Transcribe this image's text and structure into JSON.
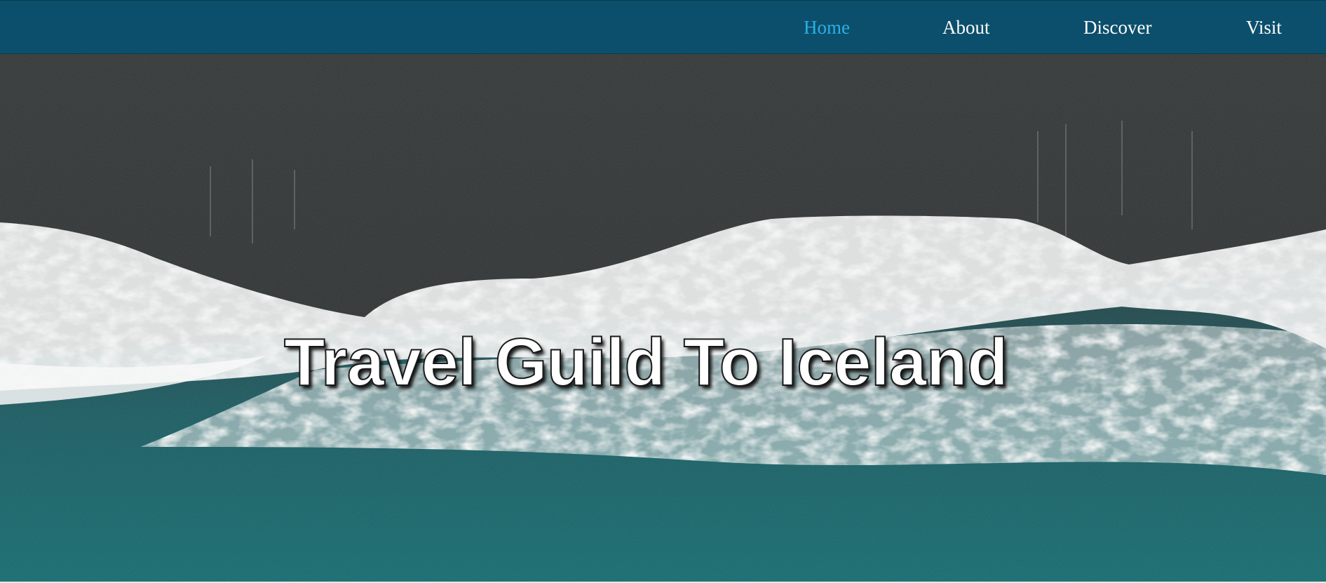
{
  "nav": {
    "items": [
      {
        "label": "Home",
        "active": true
      },
      {
        "label": "About",
        "active": false
      },
      {
        "label": "Discover",
        "active": false
      },
      {
        "label": "Visit",
        "active": false
      }
    ]
  },
  "hero": {
    "title": "Travel Guild To Iceland"
  },
  "colors": {
    "navbar_background": "#0b4f6c",
    "nav_text": "#ffffff",
    "nav_active": "#2bb0e6",
    "hero_title": "#ffffff"
  }
}
